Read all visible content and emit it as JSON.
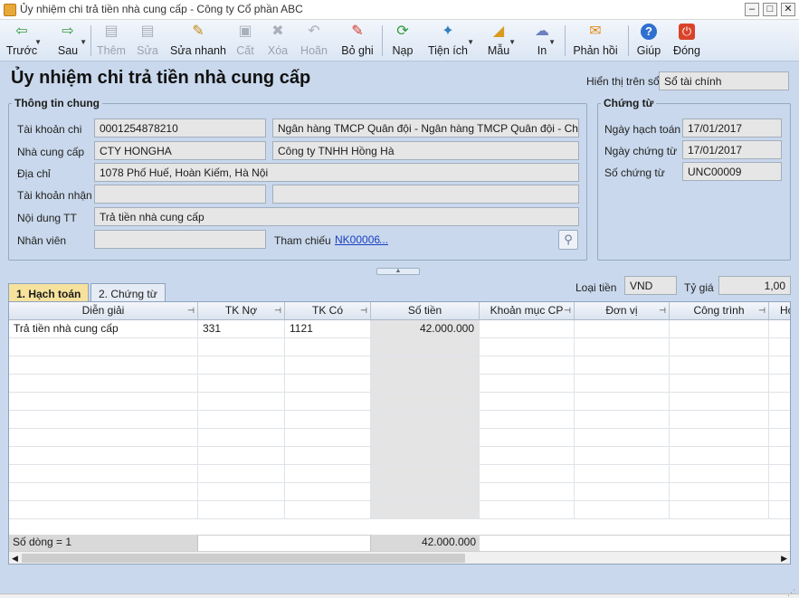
{
  "window": {
    "title": "Ủy nhiệm chi trả tiền nhà cung cấp - Công ty Cổ phần ABC",
    "minimize": "–",
    "maximize": "□",
    "close": "✕"
  },
  "toolbar": {
    "items": [
      {
        "label": "Trước",
        "icon": "arrow-left-icon",
        "glyph": "⇦",
        "color": "#2e9b3b",
        "enabled": true
      },
      {
        "label": "Sau",
        "icon": "arrow-right-icon",
        "glyph": "⇨",
        "color": "#2e9b3b",
        "enabled": true
      },
      {
        "label": "Thêm",
        "icon": "add-document-icon",
        "glyph": "▤",
        "enabled": false
      },
      {
        "label": "Sửa",
        "icon": "edit-document-icon",
        "glyph": "▤",
        "enabled": false
      },
      {
        "label": "Sửa nhanh",
        "icon": "quick-edit-icon",
        "glyph": "✎",
        "color": "#c48a17",
        "enabled": true
      },
      {
        "label": "Cất",
        "icon": "save-icon",
        "glyph": "▣",
        "enabled": false
      },
      {
        "label": "Xóa",
        "icon": "delete-icon",
        "glyph": "✖",
        "enabled": false
      },
      {
        "label": "Hoãn",
        "icon": "undo-icon",
        "glyph": "↶",
        "enabled": false
      },
      {
        "label": "Bỏ ghi",
        "icon": "unpost-icon",
        "glyph": "✎",
        "color": "#d23a2a",
        "enabled": true
      },
      {
        "label": "Nạp",
        "icon": "refresh-icon",
        "glyph": "⟳",
        "color": "#2e9b3b",
        "enabled": true
      },
      {
        "label": "Tiện ích",
        "icon": "utilities-icon",
        "glyph": "✦",
        "color": "#2f7fc1",
        "enabled": true
      },
      {
        "label": "Mẫu",
        "icon": "template-icon",
        "glyph": "◢",
        "color": "#d99a1e",
        "enabled": true
      },
      {
        "label": "In",
        "icon": "print-icon",
        "glyph": "☁",
        "color": "#6c7fc0",
        "enabled": true
      },
      {
        "label": "Phản hồi",
        "icon": "feedback-mail-icon",
        "glyph": "✉",
        "color": "#e08a1e",
        "enabled": true
      },
      {
        "label": "Giúp",
        "icon": "help-icon",
        "glyph": "?",
        "color": "#2f6fd0",
        "enabled": true
      },
      {
        "label": "Đóng",
        "icon": "close-doc-icon",
        "glyph": "⏻",
        "color": "#d9432a",
        "enabled": true
      }
    ]
  },
  "form": {
    "title": "Ủy nhiệm chi trả tiền nhà cung cấp",
    "display_on_label": "Hiển thị trên sổ",
    "display_on_value": "Sổ tài chính"
  },
  "general": {
    "group_title": "Thông tin chung",
    "paying_account_label": "Tài khoản chi",
    "paying_account_value": "0001254878210",
    "paying_bank_value": "Ngân hàng TMCP Quân đội  - Ngân hàng TMCP Quân đội - Chi n",
    "supplier_label": "Nhà cung cấp",
    "supplier_code": "CTY HONGHA",
    "supplier_name": "Công ty TNHH Hồng Hà",
    "address_label": "Địa chỉ",
    "address_value": "1078 Phố Huế, Hoàn Kiếm, Hà Nội",
    "receiving_account_label": "Tài khoản nhận",
    "receiving_account_value": "",
    "receiving_bank_value": "",
    "content_label": "Nội dung TT",
    "content_value": "Trả tiền nhà cung cấp",
    "employee_label": "Nhân viên",
    "employee_value": "",
    "reference_label": "Tham chiếu",
    "reference_value": "NK00006",
    "reference_more": "..."
  },
  "voucher": {
    "group_title": "Chứng từ",
    "posting_date_label": "Ngày hạch toán",
    "posting_date_value": "17/01/2017",
    "voucher_date_label": "Ngày chứng từ",
    "voucher_date_value": "17/01/2017",
    "voucher_no_label": "Số chứng từ",
    "voucher_no_value": "UNC00009"
  },
  "currency": {
    "currency_label": "Loại tiền",
    "currency_value": "VND",
    "rate_label": "Tỷ giá",
    "rate_value": "1,00"
  },
  "tabs": [
    {
      "label": "1. Hạch toán",
      "active": true
    },
    {
      "label": "2. Chứng từ",
      "active": false
    }
  ],
  "grid": {
    "columns": [
      "Diễn giải",
      "TK Nợ",
      "TK Có",
      "Số tiền",
      "Khoản mục CP",
      "Đơn vị",
      "Công trình",
      "Hợ"
    ],
    "rows": [
      {
        "description": "Trả tiền nhà cung cấp",
        "debit": "331",
        "credit": "1121",
        "amount": "42.000.000",
        "expense_item": "",
        "unit": "",
        "project": ""
      }
    ],
    "row_count": "Số dòng = 1",
    "total_amount": "42.000.000"
  }
}
